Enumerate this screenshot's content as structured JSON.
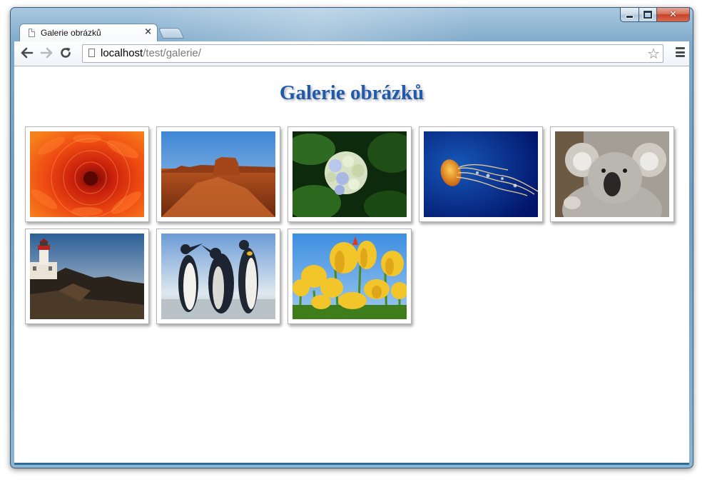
{
  "browser": {
    "tab": {
      "title": "Galerie obrázků",
      "close_icon": "×"
    },
    "address": {
      "host": "localhost",
      "path": "/test/galerie/"
    },
    "window_controls": {
      "close_label": "✕"
    }
  },
  "page": {
    "title": "Galerie obrázků",
    "title_color": "#1f5aad",
    "gallery": [
      {
        "subject": "chrysanthemum"
      },
      {
        "subject": "desert"
      },
      {
        "subject": "hydrangeas"
      },
      {
        "subject": "jellyfish"
      },
      {
        "subject": "koala"
      },
      {
        "subject": "lighthouse"
      },
      {
        "subject": "penguins"
      },
      {
        "subject": "tulips"
      }
    ]
  }
}
